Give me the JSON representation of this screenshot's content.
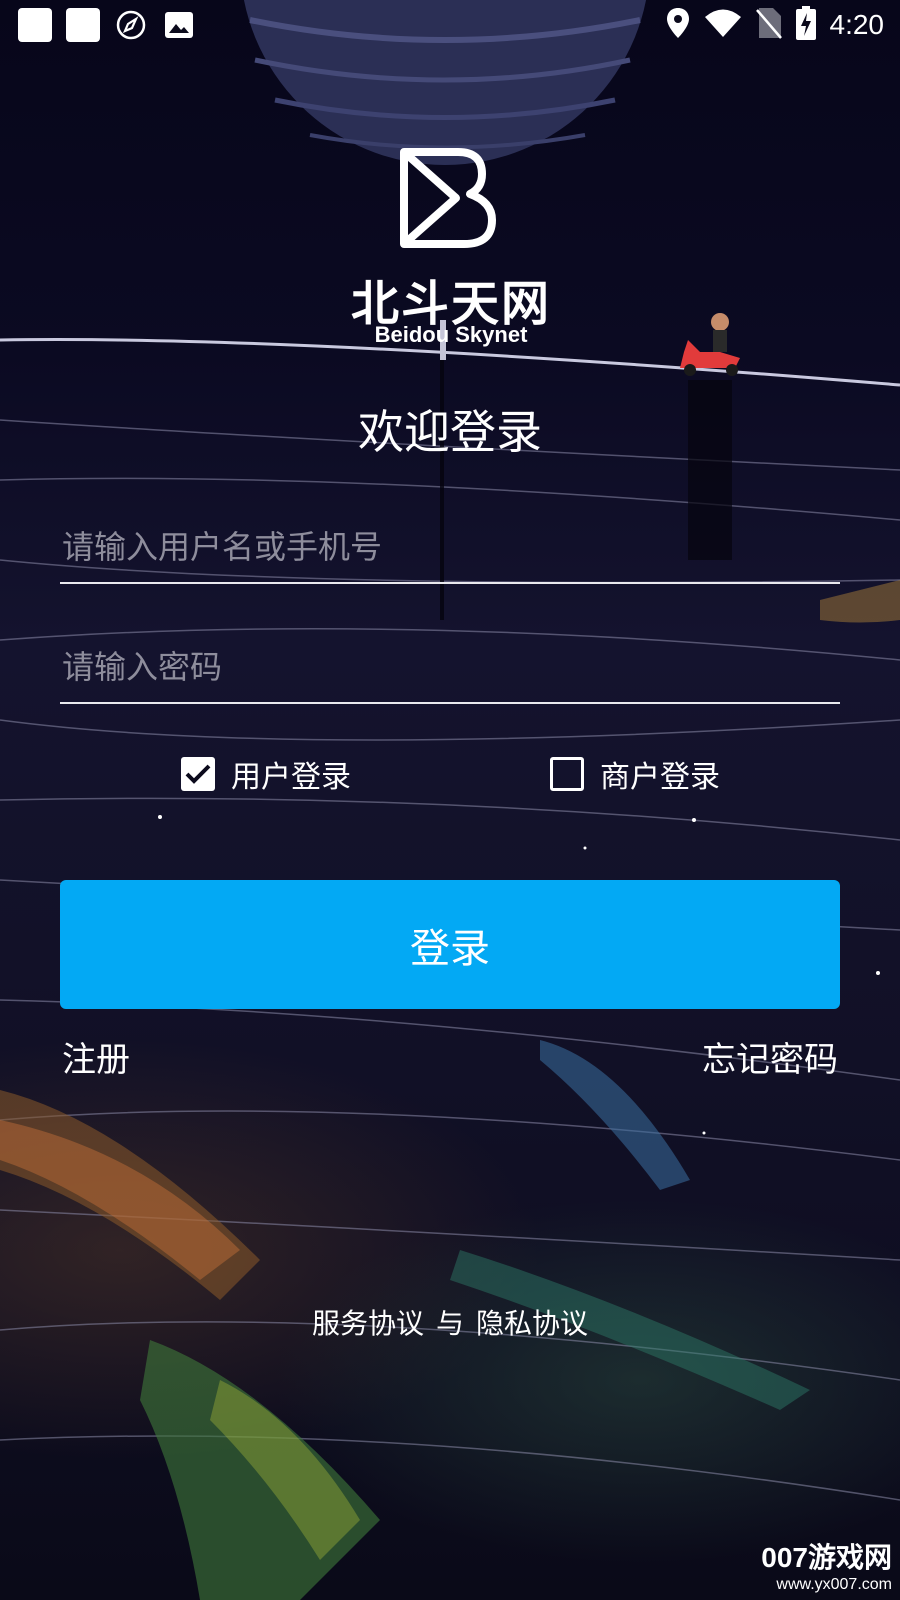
{
  "status_bar": {
    "time": "4:20",
    "left_icons": [
      "notification-square",
      "notification-square",
      "rocket-icon",
      "image-icon"
    ],
    "right_icons": [
      "location-icon",
      "wifi-icon",
      "no-sim-icon",
      "battery-charging-icon"
    ]
  },
  "brand": {
    "logo_icon": "beidou-b-logo",
    "name_cn": "北斗天网",
    "name_en": "Beidou Skynet"
  },
  "login": {
    "title": "欢迎登录",
    "username_placeholder": "请输入用户名或手机号",
    "password_placeholder": "请输入密码",
    "user_type_options": [
      {
        "label": "用户登录",
        "checked": true
      },
      {
        "label": "商户登录",
        "checked": false
      }
    ],
    "submit_label": "登录",
    "register_label": "注册",
    "forgot_label": "忘记密码"
  },
  "footer": {
    "service_agreement": "服务协议",
    "conjunction": "与",
    "privacy_agreement": "隐私协议"
  },
  "watermark": {
    "main": "007游戏网",
    "url": "www.yx007.com"
  },
  "colors": {
    "accent": "#03A9F4",
    "background": "#0B0A1C",
    "text": "#FFFFFF",
    "placeholder": "#8E8D9C"
  }
}
